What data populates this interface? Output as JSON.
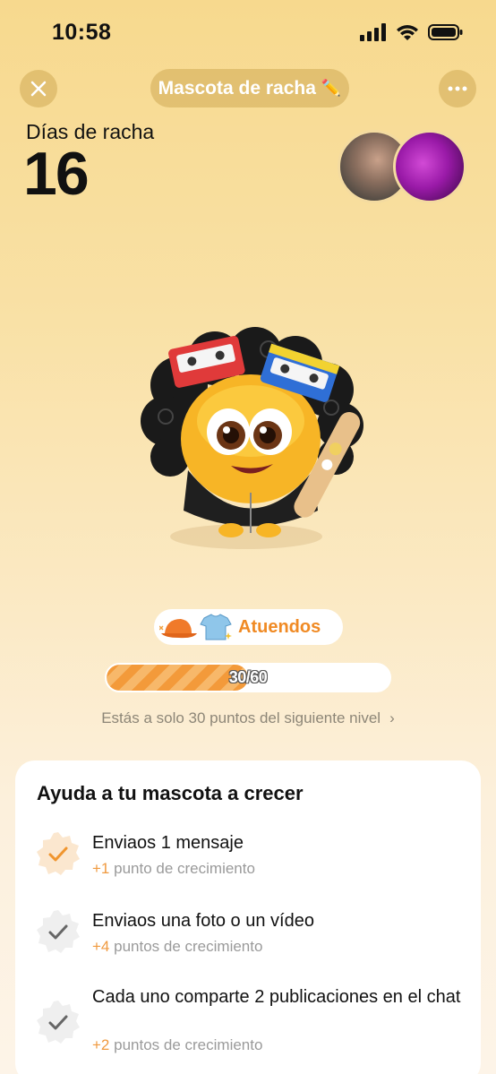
{
  "status_bar": {
    "time": "10:58"
  },
  "header": {
    "title": "Mascota de racha",
    "title_emoji": "✏️"
  },
  "streak": {
    "label": "Días de racha",
    "count": "16"
  },
  "outfits": {
    "label": "Atuendos"
  },
  "progress": {
    "current": 30,
    "max": 60,
    "text": "30/60",
    "fraction": 0.5
  },
  "next_level": {
    "text": "Estás a solo 30 puntos del siguiente nivel",
    "chevron": "›"
  },
  "growth_card": {
    "title": "Ayuda a tu mascota a crecer",
    "tasks": [
      {
        "title": "Enviaos 1 mensaje",
        "points": "+1",
        "points_label": "punto de crecimiento",
        "completed": true
      },
      {
        "title": "Enviaos una foto o un vídeo",
        "points": "+4",
        "points_label": "puntos de crecimiento",
        "completed": false
      },
      {
        "title": "Cada uno comparte 2 publicaciones en el chat",
        "points": "+2",
        "points_label": "puntos de crecimiento",
        "completed": false
      }
    ]
  },
  "colors": {
    "accent": "#f08a24",
    "background_top": "#f7d98e",
    "background_bottom": "#fdf4e8"
  }
}
